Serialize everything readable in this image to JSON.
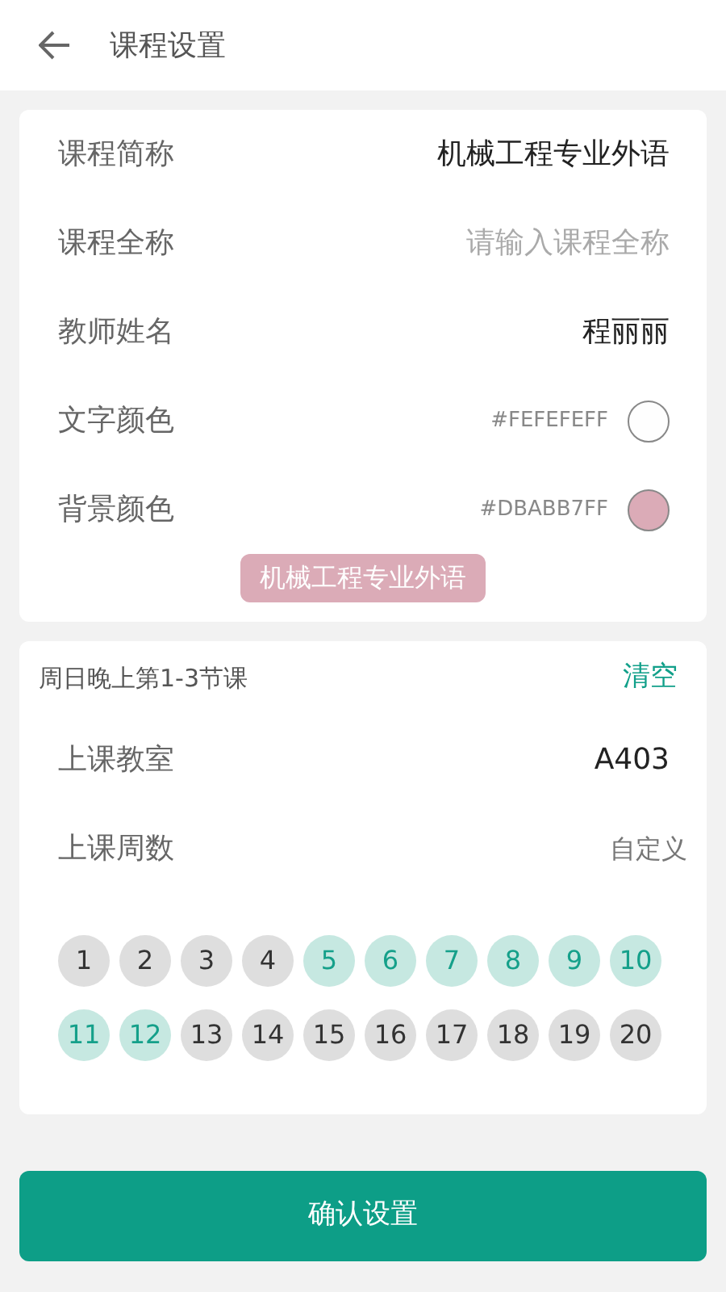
{
  "header": {
    "title": "课程设置"
  },
  "course_fields": [
    {
      "kind": "value",
      "label": "课程简称",
      "value": "机械工程专业外语"
    },
    {
      "kind": "input",
      "label": "课程全称",
      "placeholder": "请输入课程全称"
    },
    {
      "kind": "value",
      "label": "教师姓名",
      "value": "程丽丽"
    },
    {
      "kind": "color",
      "label": "文字颜色",
      "value": "#FEFEFEFF",
      "color": "#fefefe"
    },
    {
      "kind": "color",
      "label": "背景颜色",
      "value": "#DBABB7FF",
      "color": "#dbabb7"
    }
  ],
  "preview": {
    "text": "机械工程专业外语"
  },
  "session": {
    "title": "周日晚上第1-3节课",
    "clear": "清空",
    "fields": [
      {
        "label": "上课教室",
        "value": "A403",
        "kind": "value"
      },
      {
        "label": "上课周数",
        "value": "自定义",
        "kind": "option"
      }
    ],
    "weeks": [
      {
        "label": "1",
        "selected": false
      },
      {
        "label": "2",
        "selected": false
      },
      {
        "label": "3",
        "selected": false
      },
      {
        "label": "4",
        "selected": false
      },
      {
        "label": "5",
        "selected": true
      },
      {
        "label": "6",
        "selected": true
      },
      {
        "label": "7",
        "selected": true
      },
      {
        "label": "8",
        "selected": true
      },
      {
        "label": "9",
        "selected": true
      },
      {
        "label": "10",
        "selected": true
      },
      {
        "label": "11",
        "selected": true
      },
      {
        "label": "12",
        "selected": true
      },
      {
        "label": "13",
        "selected": false
      },
      {
        "label": "14",
        "selected": false
      },
      {
        "label": "15",
        "selected": false
      },
      {
        "label": "16",
        "selected": false
      },
      {
        "label": "17",
        "selected": false
      },
      {
        "label": "18",
        "selected": false
      },
      {
        "label": "19",
        "selected": false
      },
      {
        "label": "20",
        "selected": false
      }
    ]
  },
  "confirm_button": "确认设置"
}
